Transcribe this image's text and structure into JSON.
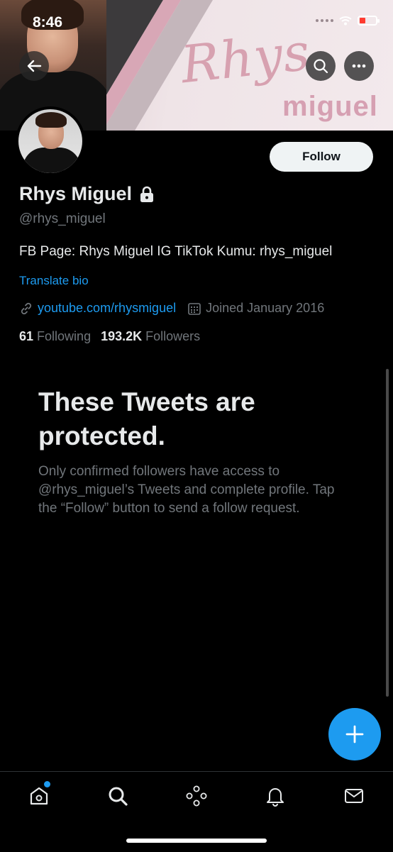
{
  "status_bar": {
    "time": "8:46"
  },
  "banner": {
    "script_text": "Rhys",
    "name_text": "miguel"
  },
  "profile": {
    "display_name": "Rhys Miguel",
    "handle": "@rhys_miguel",
    "bio": "FB Page: Rhys Miguel IG TikTok Kumu: rhys_miguel",
    "translate_label": "Translate bio",
    "website": "youtube.com/rhysmiguel",
    "joined": "Joined January 2016",
    "following_count": "61",
    "following_label": "Following",
    "followers_count": "193.2K",
    "followers_label": "Followers",
    "follow_button_label": "Follow"
  },
  "protected": {
    "title": "These Tweets are protected.",
    "body": "Only confirmed followers have access to @rhys_miguel’s Tweets and complete profile. Tap the “Follow” button to send a follow request."
  },
  "icons": {
    "back": "back-arrow-icon",
    "search": "search-icon",
    "more": "more-icon",
    "lock": "lock-icon",
    "link": "link-icon",
    "calendar": "calendar-icon",
    "compose": "plus-icon",
    "nav": [
      "home-icon",
      "search-icon",
      "spaces-icon",
      "bell-icon",
      "mail-icon"
    ]
  },
  "colors": {
    "accent": "#1d9bf0",
    "background": "#000000",
    "muted": "#71767b"
  }
}
